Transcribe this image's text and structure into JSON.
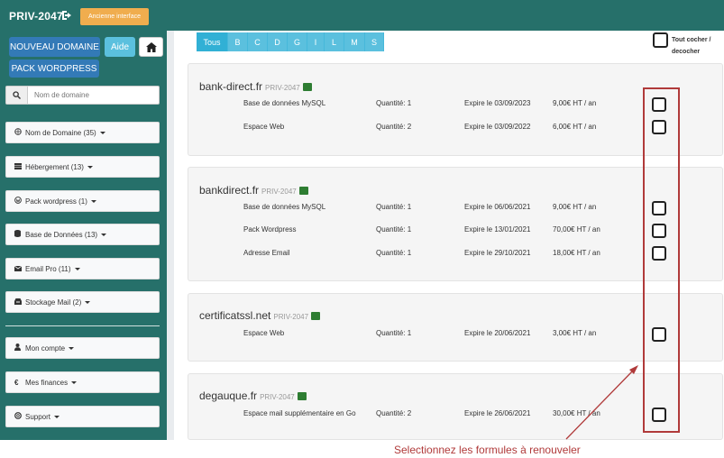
{
  "header": {
    "brand": "PRIV-2047",
    "logout_icon": "sign-out-icon",
    "old_interface_label": "Ancienne interface"
  },
  "sidebar": {
    "new_domain_label": "NOUVEAU DOMAINE",
    "help_label": "Aide",
    "home_icon": "home-icon",
    "wordpress_pack_label": "PACK WORDPRESS",
    "search_placeholder": "Nom de domaine",
    "items": [
      {
        "label": "Nom de Domaine (35)",
        "icon": "globe-icon"
      },
      {
        "label": "Hébergement (13)",
        "icon": "server-icon"
      },
      {
        "label": "Pack wordpress (1)",
        "icon": "wordpress-icon"
      },
      {
        "label": "Base de Données (13)",
        "icon": "database-icon"
      },
      {
        "label": "Email Pro (11)",
        "icon": "envelope-icon"
      },
      {
        "label": "Stockage Mail (2)",
        "icon": "archive-icon"
      },
      {
        "label": "Mon compte",
        "icon": "user-icon"
      },
      {
        "label": "Mes finances",
        "icon": "euro-icon"
      },
      {
        "label": "Support",
        "icon": "life-ring-icon"
      }
    ]
  },
  "filter": {
    "letters": [
      "Tous",
      "B",
      "C",
      "D",
      "G",
      "I",
      "L",
      "M",
      "S"
    ],
    "select_all_label": "Tout cocher / decocher"
  },
  "domains": [
    {
      "name": "bank-direct.fr",
      "tag": "PRIV-2047",
      "services": [
        {
          "name": "Base de données MySQL",
          "qty": "Quantité: 1",
          "expiry": "Expire le 03/09/2023",
          "price": "9,00€ HT / an"
        },
        {
          "name": "Espace Web",
          "qty": "Quantité: 2",
          "expiry": "Expire le 03/09/2022",
          "price": "6,00€ HT / an"
        }
      ]
    },
    {
      "name": "bankdirect.fr",
      "tag": "PRIV-2047",
      "services": [
        {
          "name": "Base de données MySQL",
          "qty": "Quantité: 1",
          "expiry": "Expire le 06/06/2021",
          "price": "9,00€ HT / an"
        },
        {
          "name": "Pack Wordpress",
          "qty": "Quantité: 1",
          "expiry": "Expire le 13/01/2021",
          "price": "70,00€ HT / an"
        },
        {
          "name": "Adresse Email",
          "qty": "Quantité: 1",
          "expiry": "Expire le 29/10/2021",
          "price": "18,00€ HT / an"
        }
      ]
    },
    {
      "name": "certificatssl.net",
      "tag": "PRIV-2047",
      "services": [
        {
          "name": "Espace Web",
          "qty": "Quantité: 1",
          "expiry": "Expire le 20/06/2021",
          "price": "3,00€ HT / an"
        }
      ]
    },
    {
      "name": "degauque.fr",
      "tag": "PRIV-2047",
      "services": [
        {
          "name": "Espace mail supplémentaire en Go",
          "qty": "Quantité: 2",
          "expiry": "Expire le 26/06/2021",
          "price": "30,00€ HT / an"
        }
      ]
    }
  ],
  "annotation": "Selectionnez les formules à renouveler",
  "colors": {
    "sidebar": "#26706a",
    "primary_button": "#337ab7",
    "info_button": "#5bc0de",
    "warning_button": "#f0ad4e",
    "annotation": "#b03a3a",
    "product_icon": "#2e7d32"
  }
}
